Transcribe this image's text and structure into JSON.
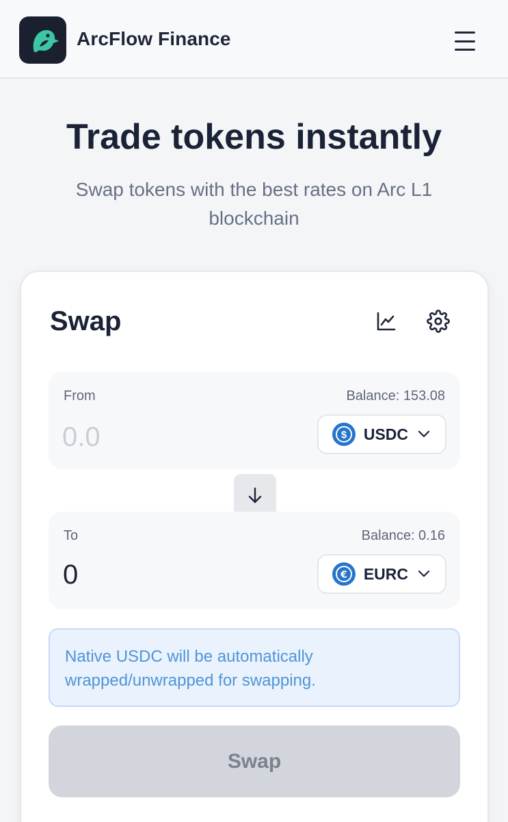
{
  "header": {
    "brand": "ArcFlow Finance",
    "logo_icon": "bird-logo-icon",
    "menu_icon": "hamburger-menu-icon"
  },
  "hero": {
    "title": "Trade tokens instantly",
    "subtitle": "Swap tokens with the best rates on Arc L1 blockchain"
  },
  "swap": {
    "title": "Swap",
    "chart_icon": "chart-icon",
    "settings_icon": "gear-icon",
    "from": {
      "label": "From",
      "balance": "Balance: 153.08",
      "placeholder": "0.0",
      "value": "",
      "token": "USDC",
      "token_icon": "usdc-dollar-icon"
    },
    "switch_icon": "arrow-down-icon",
    "to": {
      "label": "To",
      "balance": "Balance: 0.16",
      "amount": "0",
      "token": "EURC",
      "token_icon": "eurc-euro-icon"
    },
    "info": "Native USDC will be automatically wrapped/unwrapped for swapping.",
    "submit_label": "Swap"
  },
  "colors": {
    "accent_teal": "#3cc6a5",
    "token_blue": "#2775ca",
    "info_text": "#4f95d8",
    "disabled_button": "#d2d5db"
  }
}
